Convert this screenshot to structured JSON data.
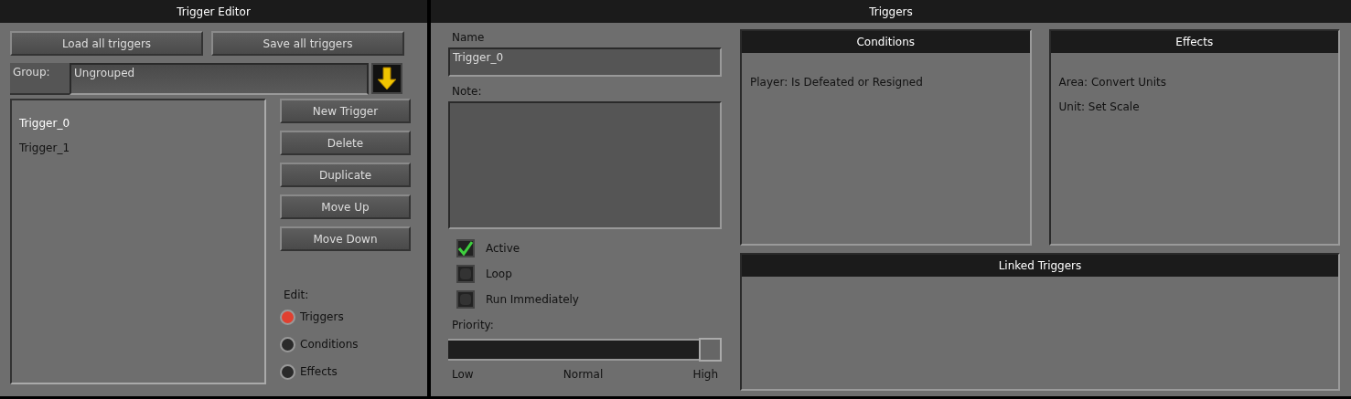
{
  "trigger_editor": {
    "title": "Trigger Editor",
    "file_buttons": [
      "Load all triggers",
      "Save all triggers"
    ],
    "group": {
      "label": "Group:",
      "value": "Ungrouped"
    },
    "triggers": [
      {
        "label": "Trigger_0",
        "selected": true
      },
      {
        "label": "Trigger_1",
        "selected": false
      }
    ],
    "actions": [
      "New Trigger",
      "Delete",
      "Duplicate",
      "Move Up",
      "Move Down"
    ],
    "edit": {
      "label": "Edit:",
      "options": [
        {
          "label": "Triggers",
          "selected": true
        },
        {
          "label": "Conditions",
          "selected": false
        },
        {
          "label": "Effects",
          "selected": false
        }
      ]
    }
  },
  "triggers_panel": {
    "title": "Triggers",
    "name": {
      "label": "Name",
      "value": "Trigger_0"
    },
    "note": {
      "label": "Note:"
    },
    "options": [
      {
        "label": "Active",
        "checked": true
      },
      {
        "label": "Loop",
        "checked": false
      },
      {
        "label": "Run Immediately",
        "checked": false
      }
    ],
    "priority": {
      "label": "Priority:",
      "level": 1,
      "ticks": [
        "Low",
        "Normal",
        "High"
      ]
    },
    "conditions": {
      "title": "Conditions",
      "items": [
        "Player: Is Defeated or Resigned"
      ]
    },
    "effects": {
      "title": "Effects",
      "items": [
        "Area: Convert Units",
        "Unit: Set Scale"
      ]
    },
    "linked_triggers": {
      "title": "Linked Triggers"
    }
  }
}
